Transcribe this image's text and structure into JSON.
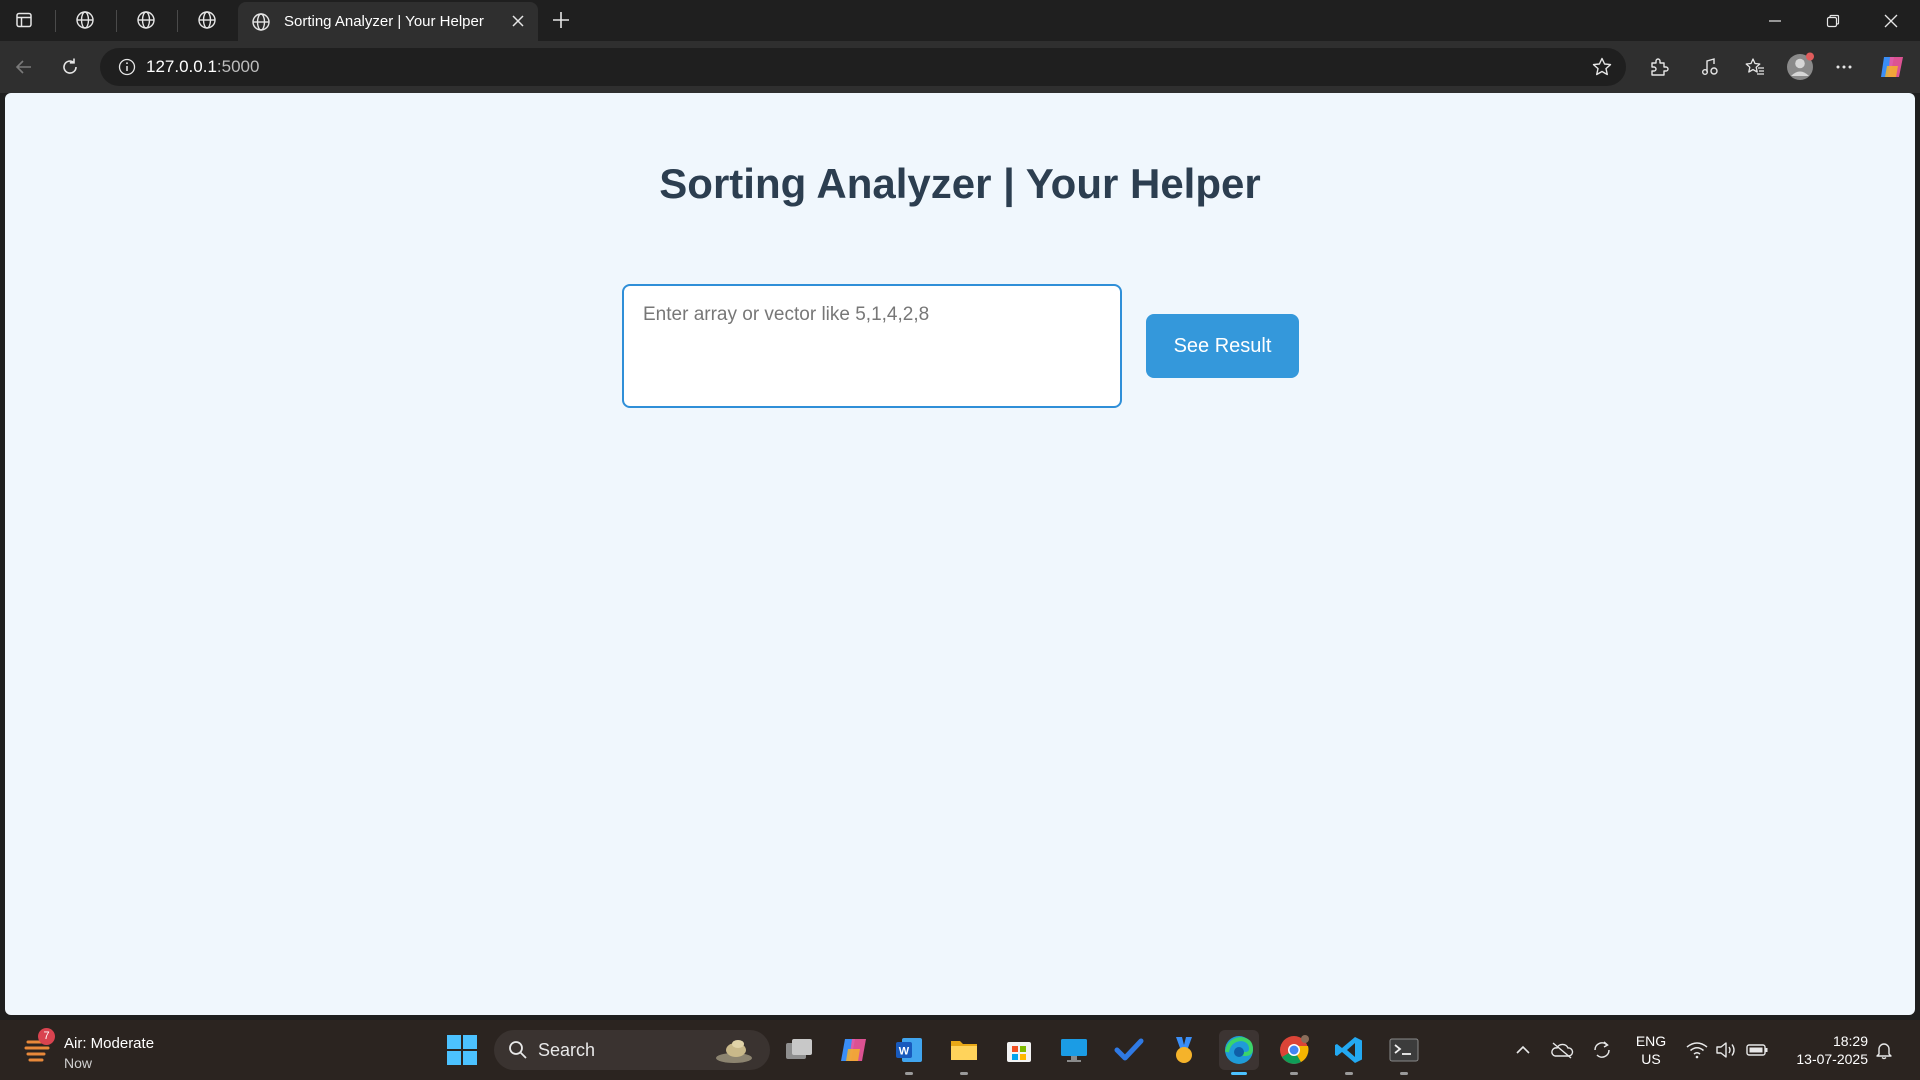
{
  "browser": {
    "active_tab_title": "Sorting Analyzer | Your Helper",
    "url_host": "127.0.0.1",
    "url_port": ":5000"
  },
  "page": {
    "title": "Sorting Analyzer | Your Helper",
    "input_placeholder": "Enter array or vector like 5,1,4,2,8",
    "input_value": "",
    "button_label": "See Result"
  },
  "colors": {
    "page_background": "#f0f7fd",
    "title_color": "#2c3e50",
    "accent": "#3498db",
    "input_border": "#2f8fd8"
  },
  "taskbar": {
    "weather_title": "Air: Moderate",
    "weather_subtitle": "Now",
    "weather_badge": "7",
    "search_label": "Search",
    "lang_line1": "ENG",
    "lang_line2": "US",
    "time": "18:29",
    "date": "13-07-2025",
    "apps": [
      "task-view",
      "copilot",
      "word",
      "file-explorer",
      "microsoft-store",
      "remote-desktop",
      "todo",
      "medal",
      "edge",
      "chrome",
      "vscode",
      "terminal"
    ]
  }
}
